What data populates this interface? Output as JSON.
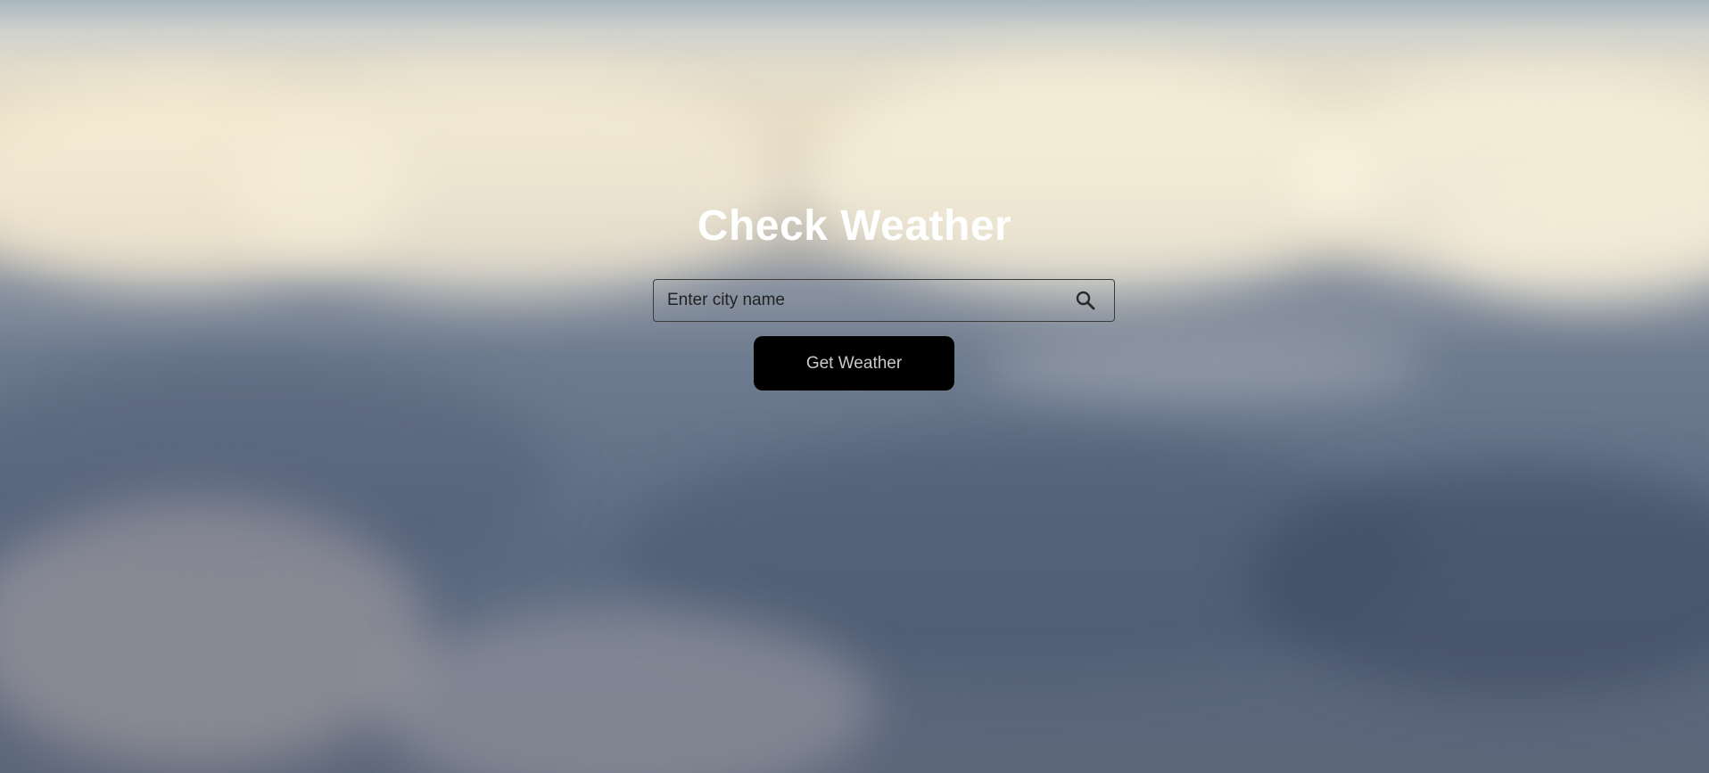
{
  "page": {
    "title": "Check Weather"
  },
  "search": {
    "placeholder": "Enter city name",
    "value": "",
    "icon": "search-icon"
  },
  "actions": {
    "get_weather_label": "Get Weather"
  },
  "colors": {
    "title_text": "#ffffff",
    "button_bg": "#000000",
    "button_text": "#c9c9c9",
    "input_border": "#3b3b3b"
  },
  "background": {
    "description_icon": "cloud-background"
  }
}
